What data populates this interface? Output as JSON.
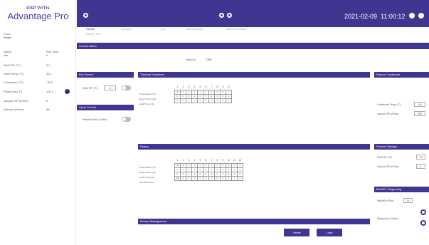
{
  "brand": {
    "company": "GSP VirTis",
    "product": "Advantage Pro"
  },
  "sidebar": {
    "phase_label": "Phase",
    "phase_value": "Recipe",
    "header_name": "Name",
    "header_value": "Run Time",
    "status_label": "Idle",
    "status_value": "0",
    "items": [
      {
        "label": "Shelf SP (°C)",
        "value": "0.0"
      },
      {
        "label": "Shelf Temp (°C)",
        "value": "20.1"
      },
      {
        "label": "Condenser (°C)",
        "value": "-35.0"
      },
      {
        "label": "Pirani Avg (°C)",
        "value": "100.1"
      },
      {
        "label": "Vacuum SP (mTorr)",
        "value": "0"
      },
      {
        "label": "Vacuum (mTorr)",
        "value": "88"
      }
    ]
  },
  "topbar": {
    "date": "2021-02-09",
    "time": "11:00:12"
  },
  "tabs": [
    {
      "label": "Recipe",
      "active": true
    },
    {
      "label": "Synoptic",
      "active": false
    },
    {
      "label": "Cell",
      "active": false
    },
    {
      "label": "Manual Mode",
      "active": false
    },
    {
      "label": "Alarm Summary",
      "active": false
    }
  ],
  "tab_sub": "Recipe Info",
  "current_batch": {
    "bar": "Current Batch",
    "text": "Batch ID",
    "value": "ONE"
  },
  "pre_freeze": {
    "bar": "Pre-Freeze",
    "label": "Shelf SP (°C)",
    "value": "-5"
  },
  "cycle_control": {
    "bar": "Cycle Control",
    "label": "Manual Ramp Control"
  },
  "thermal": {
    "bar": "Thermal Treatment",
    "cols": [
      "1",
      "2",
      "3",
      "4",
      "5",
      "6",
      "7",
      "8",
      "9",
      "10"
    ],
    "rows": [
      {
        "label": "Temperature (°C)",
        "cells": [
          "-34",
          "-5",
          "0",
          "0",
          "0",
          "0",
          "0",
          "0",
          "0",
          "0"
        ]
      },
      {
        "label": "Ramp Time (min)",
        "cells": [
          "0",
          "0",
          "0",
          "0",
          "0",
          "0",
          "0",
          "0",
          "0",
          "0"
        ]
      },
      {
        "label": "Hold Time (min)",
        "cells": [
          "0",
          "0",
          "0",
          "0",
          "0",
          "0",
          "0",
          "0",
          "0",
          "0"
        ]
      }
    ]
  },
  "freeze_condenser": {
    "bar": "Freeze Condenser",
    "items": [
      {
        "label": "Condenser Temp (°C)",
        "value": "-40"
      },
      {
        "label": "Vacuum SP (mTorr)",
        "value": "500"
      }
    ]
  },
  "drying": {
    "bar": "Drying",
    "cols": [
      "1",
      "2",
      "3",
      "4",
      "5",
      "6",
      "7",
      "8",
      "9",
      "10",
      "11",
      "12"
    ],
    "rows": [
      {
        "label": "Temperature (°C)",
        "cells": [
          "-34",
          "0",
          "0",
          "0",
          "0",
          "0",
          "0",
          "0",
          "0",
          "0",
          "0",
          "0"
        ]
      },
      {
        "label": "Ramp Time (min)",
        "cells": [
          "0",
          "0",
          "0",
          "0",
          "0",
          "0",
          "0",
          "0",
          "0",
          "0",
          "0",
          "0"
        ]
      },
      {
        "label": "Hold Time (min)",
        "cells": [
          "0",
          "0",
          "0",
          "0",
          "0",
          "0",
          "0",
          "0",
          "0",
          "0",
          "0",
          "0"
        ]
      },
      {
        "label": "Vac SP (mTorr)",
        "cells": [
          "100",
          "0",
          "0",
          "0",
          "0",
          "0",
          "0",
          "0",
          "0",
          "0",
          "0",
          "0"
        ]
      }
    ]
  },
  "product_storage": {
    "bar": "Product Storage",
    "items": [
      {
        "label": "Shelf SP (°C)",
        "value": "-20"
      },
      {
        "label": "Vacuum SP (mTorr)",
        "value": "0"
      }
    ]
  },
  "backfill": {
    "bar": "Backfill / Stoppering",
    "label": "Backfill (mTorr)",
    "value": "25",
    "stopper_label": "Stoppering Control"
  },
  "recipe_mgmt": {
    "bar": "Recipe Management",
    "delete": "Delete",
    "load": "Load"
  }
}
